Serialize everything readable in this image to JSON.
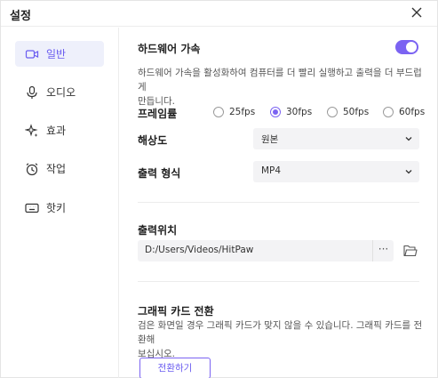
{
  "window": {
    "title": "설정"
  },
  "sidebar": {
    "items": [
      {
        "label": "일반",
        "icon": "camera-icon",
        "active": true
      },
      {
        "label": "오디오",
        "icon": "microphone-icon",
        "active": false
      },
      {
        "label": "효과",
        "icon": "sparkle-icon",
        "active": false
      },
      {
        "label": "작업",
        "icon": "clock-icon",
        "active": false
      },
      {
        "label": "핫키",
        "icon": "keyboard-icon",
        "active": false
      }
    ]
  },
  "general": {
    "hw_accel": {
      "title": "하드웨어 가속",
      "description_line1": "하드웨어 가속을 활성화하여 컴퓨터를 더 빨리 실행하고 출력을 더 부드럽게",
      "description_line2": "만듭니다.",
      "enabled": true
    },
    "framerate": {
      "label": "프레임률",
      "options": [
        "25fps",
        "30fps",
        "50fps",
        "60fps"
      ],
      "selected": "30fps"
    },
    "resolution": {
      "label": "해상도",
      "value": "원본"
    },
    "output_format": {
      "label": "출력 형식",
      "value": "MP4"
    },
    "output_location": {
      "label": "출력위치",
      "path": "D:/Users/Videos/HitPaw",
      "more_label": "···"
    },
    "graphics_card": {
      "title": "그래픽 카드 전환",
      "description_line1": "검은 화면일 경우 그래픽 카드가 맞지 않을 수 있습니다. 그래픽 카드를 전환해",
      "description_line2": "보십시오.",
      "button_label": "전환하기"
    }
  },
  "colors": {
    "accent": "#7b63f2",
    "active_bg": "#eef0fb"
  }
}
